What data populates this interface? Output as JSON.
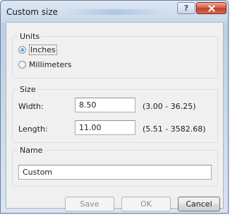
{
  "window": {
    "title": "Custom size"
  },
  "units": {
    "label": "Units",
    "options": [
      {
        "label": "Inches",
        "checked": true
      },
      {
        "label": "Millimeters",
        "checked": false
      }
    ]
  },
  "size": {
    "label": "Size",
    "width": {
      "label": "Width:",
      "value": "8.50",
      "range": "(3.00 - 36.25)"
    },
    "length": {
      "label": "Length:",
      "value": "11.00",
      "range": "(5.51 - 3582.68)"
    }
  },
  "name": {
    "label": "Name",
    "value": "Custom"
  },
  "buttons": {
    "save": "Save",
    "ok": "OK",
    "cancel": "Cancel"
  }
}
